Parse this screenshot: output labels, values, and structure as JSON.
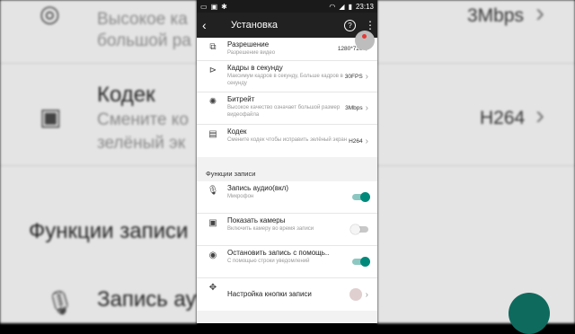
{
  "background": {
    "left_items": [
      {
        "title": "",
        "sub": "Высокое ка",
        "sub2": "большой ра"
      },
      {
        "title": "Кодек",
        "sub": "Смените ко",
        "sub2": "зелёный эк"
      },
      {
        "section": "Функции записи"
      },
      {
        "title": "Запись ау",
        "sub": "Микрофон"
      }
    ],
    "right_items": [
      {
        "value": "3Mbps"
      },
      {
        "value": "H264"
      }
    ]
  },
  "statusbar": {
    "time": "23:13",
    "left_icons": [
      "camera-icon",
      "image-icon",
      "bug-icon"
    ],
    "right_icons": [
      "wifi-icon",
      "signal-icon",
      "battery-icon"
    ]
  },
  "appbar": {
    "title": "Установка"
  },
  "settings": [
    {
      "title": "Разрешение",
      "sub": "Разрешение видео",
      "value": "1280*720",
      "icon": "resolution-icon"
    },
    {
      "title": "Кадры в секунду",
      "sub": "Максимум кадров в секунду, Больше кадров в секунду",
      "value": "30FPS",
      "icon": "fps-icon"
    },
    {
      "title": "Битрейт",
      "sub": "Высокое качество означает большой размер видеофайла",
      "value": "3Mbps",
      "icon": "bitrate-icon"
    },
    {
      "title": "Кодек",
      "sub": "Смените кодек чтобы исправить зелёный экран",
      "value": "H264",
      "icon": "codec-icon"
    }
  ],
  "section_title": "Функции записи",
  "record_settings": [
    {
      "title": "Запись аудио(вкл)",
      "sub": "Микрофон",
      "toggle": true,
      "icon": "mic-icon"
    },
    {
      "title": "Показать камеры",
      "sub": "Включить камеру во время записи",
      "toggle": false,
      "icon": "camera-icon"
    },
    {
      "title": "Остановить запись с помощь..",
      "sub": "С помощью строки уведомлений",
      "toggle": true,
      "icon": "stop-icon"
    },
    {
      "title": "Настройка кнопки записи",
      "sub": "",
      "icon": "record-button-icon"
    }
  ]
}
